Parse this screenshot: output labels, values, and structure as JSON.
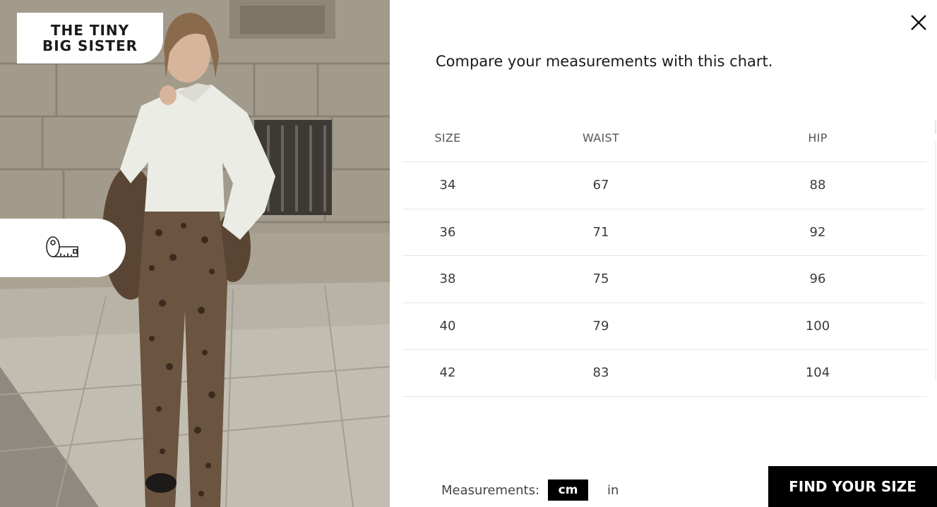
{
  "brand": {
    "line1": "THE TINY",
    "line2": "BIG SISTER"
  },
  "icons": {
    "close": "close-icon",
    "measuring_tape": "measuring-tape-icon"
  },
  "heading": "Compare your measurements with this chart.",
  "size_table": {
    "columns": [
      "SIZE",
      "WAIST",
      "HIP"
    ],
    "rows": [
      [
        "34",
        "67",
        "88"
      ],
      [
        "36",
        "71",
        "92"
      ],
      [
        "38",
        "75",
        "96"
      ],
      [
        "40",
        "79",
        "100"
      ],
      [
        "42",
        "83",
        "104"
      ]
    ]
  },
  "units": {
    "label": "Measurements:",
    "options": [
      "cm",
      "in"
    ],
    "selected": "cm"
  },
  "cta": {
    "label": "FIND YOUR SIZE"
  },
  "colors": {
    "primary_button": "#000000",
    "background": "#ffffff",
    "text": "#1a1a1a"
  }
}
